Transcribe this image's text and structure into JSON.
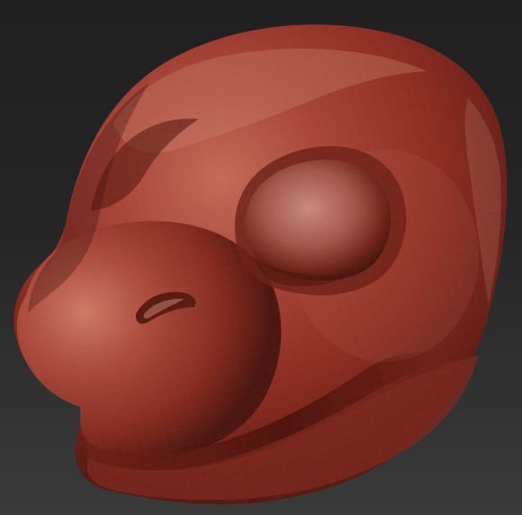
{
  "scene": {
    "subject": "sculpted-creature-head",
    "material_color": "#8e3022",
    "highlight_color": "#c87a66",
    "shadow_color": "#3c110b",
    "background_top": "#202020",
    "background_bottom": "#3a3a3a"
  }
}
